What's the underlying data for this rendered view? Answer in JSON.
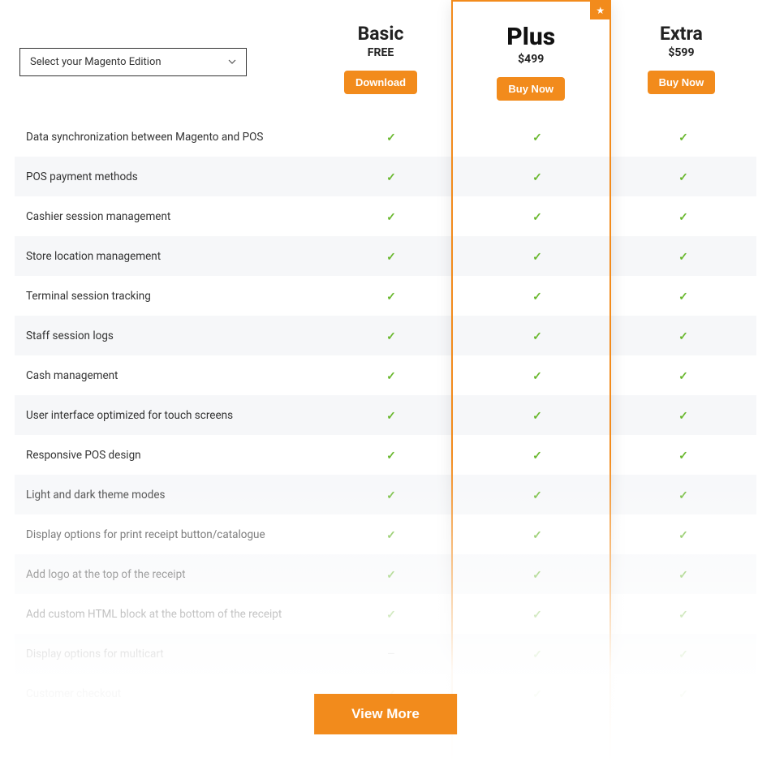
{
  "select": {
    "placeholder": "Select your Magento Edition"
  },
  "tiers": [
    {
      "name": "Basic",
      "price": "FREE",
      "cta": "Download"
    },
    {
      "name": "Plus",
      "price": "$499",
      "cta": "Buy Now",
      "featured": true
    },
    {
      "name": "Extra",
      "price": "$599",
      "cta": "Buy Now"
    }
  ],
  "features": [
    {
      "label": "Data synchronization between Magento and POS",
      "vals": [
        "check",
        "check",
        "check"
      ]
    },
    {
      "label": "POS payment methods",
      "vals": [
        "check",
        "check",
        "check"
      ]
    },
    {
      "label": "Cashier session management",
      "vals": [
        "check",
        "check",
        "check"
      ]
    },
    {
      "label": "Store location management",
      "vals": [
        "check",
        "check",
        "check"
      ]
    },
    {
      "label": "Terminal session tracking",
      "vals": [
        "check",
        "check",
        "check"
      ]
    },
    {
      "label": "Staff session logs",
      "vals": [
        "check",
        "check",
        "check"
      ]
    },
    {
      "label": "Cash management",
      "vals": [
        "check",
        "check",
        "check"
      ]
    },
    {
      "label": "User interface optimized for touch screens",
      "vals": [
        "check",
        "check",
        "check"
      ]
    },
    {
      "label": "Responsive POS design",
      "vals": [
        "check",
        "check",
        "check"
      ]
    },
    {
      "label": "Light and dark theme modes",
      "vals": [
        "check",
        "check",
        "check"
      ]
    },
    {
      "label": "Display options for print receipt button/catalogue",
      "vals": [
        "check",
        "check",
        "check"
      ]
    },
    {
      "label": "Add logo at the top of the receipt",
      "vals": [
        "check",
        "check",
        "check"
      ]
    },
    {
      "label": "Add custom HTML block at the bottom of the receipt",
      "vals": [
        "check",
        "check",
        "check"
      ]
    },
    {
      "label": "Display options for multicart",
      "vals": [
        "dash",
        "check",
        "check"
      ]
    },
    {
      "label": "Customer checkout",
      "vals": [
        "check",
        "check",
        "check"
      ]
    }
  ],
  "view_more": "View More"
}
